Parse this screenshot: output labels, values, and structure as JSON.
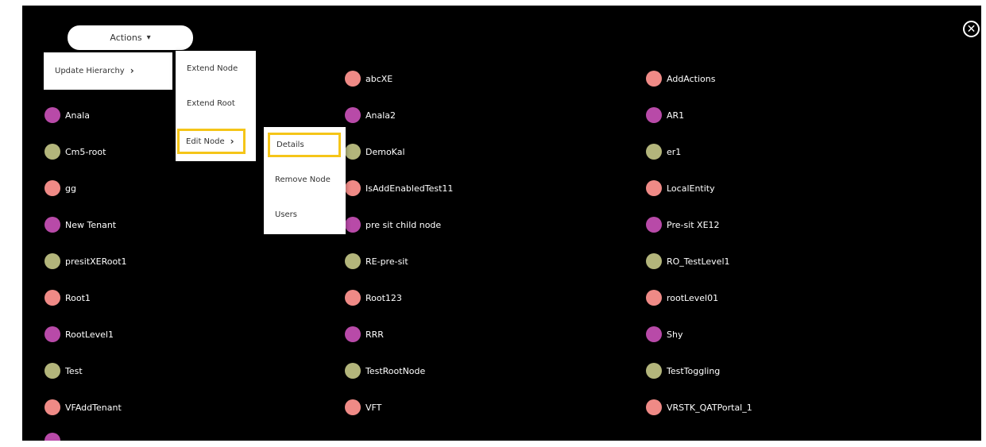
{
  "colors": {
    "pink": "#ef8a86",
    "purple": "#b84aa8",
    "olive": "#b3b57b",
    "highlight": "#f5c518"
  },
  "close_icon": "close-circle-icon",
  "actions": {
    "label": "Actions",
    "icon": "chevron-down-icon"
  },
  "menu1": {
    "update_hierarchy": "Update Hierarchy"
  },
  "menu2": {
    "extend_node": "Extend Node",
    "extend_root": "Extend Root",
    "edit_node": "Edit Node"
  },
  "menu3": {
    "details": "Details",
    "remove_node": "Remove Node",
    "users": "Users"
  },
  "nodes": {
    "col1": [
      {
        "label": "Anala",
        "color": "purple"
      },
      {
        "label": "Cm5-root",
        "color": "olive"
      },
      {
        "label": "gg",
        "color": "pink"
      },
      {
        "label": "New Tenant",
        "color": "purple"
      },
      {
        "label": "presitXERoot1",
        "color": "olive"
      },
      {
        "label": "Root1",
        "color": "pink"
      },
      {
        "label": "RootLevel1",
        "color": "purple"
      },
      {
        "label": "Test",
        "color": "olive"
      },
      {
        "label": "VFAddTenant",
        "color": "pink"
      }
    ],
    "col2": [
      {
        "label": "abcXE",
        "color": "pink"
      },
      {
        "label": "Anala2",
        "color": "purple"
      },
      {
        "label": "DemoKal",
        "color": "olive"
      },
      {
        "label": "IsAddEnabledTest11",
        "color": "pink"
      },
      {
        "label": "pre sit child node",
        "color": "purple"
      },
      {
        "label": "RE-pre-sit",
        "color": "olive"
      },
      {
        "label": "Root123",
        "color": "pink"
      },
      {
        "label": "RRR",
        "color": "purple"
      },
      {
        "label": "TestRootNode",
        "color": "olive"
      },
      {
        "label": "VFT",
        "color": "pink"
      }
    ],
    "col3": [
      {
        "label": "AddActions",
        "color": "pink"
      },
      {
        "label": "AR1",
        "color": "purple"
      },
      {
        "label": "er1",
        "color": "olive"
      },
      {
        "label": "LocalEntity",
        "color": "pink"
      },
      {
        "label": "Pre-sit XE12",
        "color": "purple"
      },
      {
        "label": "RO_TestLevel1",
        "color": "olive"
      },
      {
        "label": "rootLevel01",
        "color": "pink"
      },
      {
        "label": "Shy",
        "color": "purple"
      },
      {
        "label": "TestToggling",
        "color": "olive"
      },
      {
        "label": "VRSTK_QATPortal_1",
        "color": "pink"
      }
    ]
  }
}
